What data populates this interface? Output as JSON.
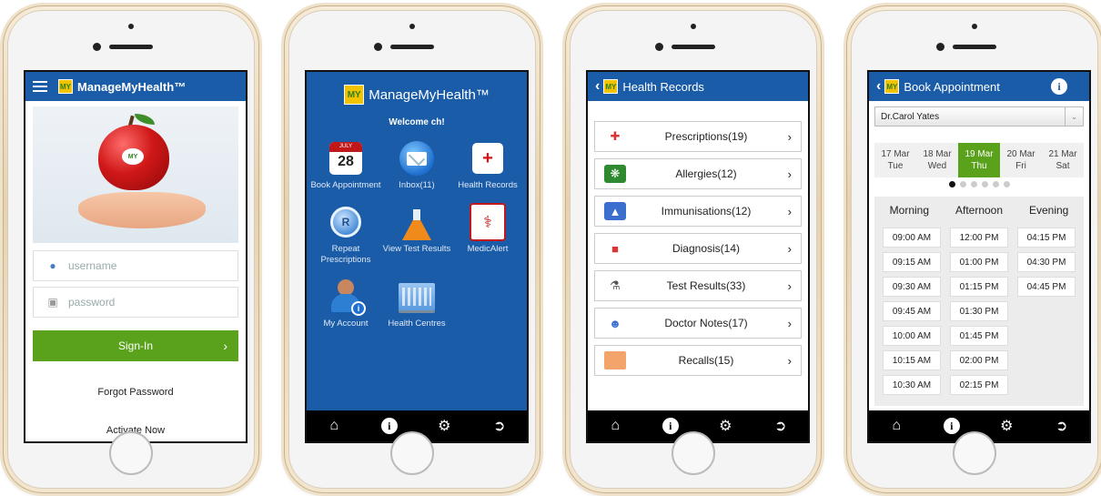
{
  "colors": {
    "brand_blue": "#1a5ca8",
    "action_green": "#5aa21c",
    "tabbar_black": "#000000"
  },
  "brand_name": "ManageMyHealth™",
  "logo_text": "MY",
  "tabbar": {
    "icons": [
      "home-icon",
      "info-icon",
      "settings-icon",
      "logout-icon"
    ]
  },
  "login": {
    "apple_label": "MY",
    "username_placeholder": "username",
    "password_placeholder": "password",
    "signin_label": "Sign-In",
    "forgot_label": "Forgot Password",
    "activate_label": "Activate Now"
  },
  "dashboard": {
    "welcome": "Welcome ch!",
    "calendar_month": "JULY",
    "calendar_day": "28",
    "tiles": [
      {
        "label": "Book Appointment",
        "icon": "calendar-icon"
      },
      {
        "label": "Inbox(11)",
        "icon": "mail-icon"
      },
      {
        "label": "Health Records",
        "icon": "medical-kit-icon"
      },
      {
        "label": "Repeat Prescriptions",
        "icon": "rx-icon"
      },
      {
        "label": "View Test Results",
        "icon": "flask-icon"
      },
      {
        "label": "MedicAlert",
        "icon": "medicalert-icon"
      },
      {
        "label": "My Account",
        "icon": "account-icon"
      },
      {
        "label": "Health Centres",
        "icon": "building-icon"
      }
    ]
  },
  "records": {
    "title": "Health Records",
    "items": [
      {
        "label": "Prescriptions(19)",
        "icon": "prescription-icon"
      },
      {
        "label": "Allergies(12)",
        "icon": "allergy-icon"
      },
      {
        "label": "Immunisations(12)",
        "icon": "immunisation-icon"
      },
      {
        "label": "Diagnosis(14)",
        "icon": "diagnosis-icon"
      },
      {
        "label": "Test Results(33)",
        "icon": "microscope-icon"
      },
      {
        "label": "Doctor Notes(17)",
        "icon": "doctors-icon"
      },
      {
        "label": "Recalls(15)",
        "icon": "recall-icon"
      }
    ]
  },
  "appointment": {
    "title": "Book Appointment",
    "doctor": "Dr.Carol Yates",
    "dates": [
      {
        "date": "17 Mar",
        "day": "Tue",
        "selected": false
      },
      {
        "date": "18 Mar",
        "day": "Wed",
        "selected": false
      },
      {
        "date": "19 Mar",
        "day": "Thu",
        "selected": true
      },
      {
        "date": "20 Mar",
        "day": "Fri",
        "selected": false
      },
      {
        "date": "21 Mar",
        "day": "Sat",
        "selected": false
      }
    ],
    "page_dots": 6,
    "active_dot": 0,
    "columns": [
      "Morning",
      "Afternoon",
      "Evening"
    ],
    "morning": [
      "09:00 AM",
      "09:15 AM",
      "09:30 AM",
      "09:45 AM",
      "10:00 AM",
      "10:15 AM",
      "10:30 AM"
    ],
    "afternoon": [
      "12:00 PM",
      "01:00 PM",
      "01:15 PM",
      "01:30 PM",
      "01:45 PM",
      "02:00 PM",
      "02:15 PM"
    ],
    "evening": [
      "04:15 PM",
      "04:30 PM",
      "04:45 PM"
    ]
  }
}
